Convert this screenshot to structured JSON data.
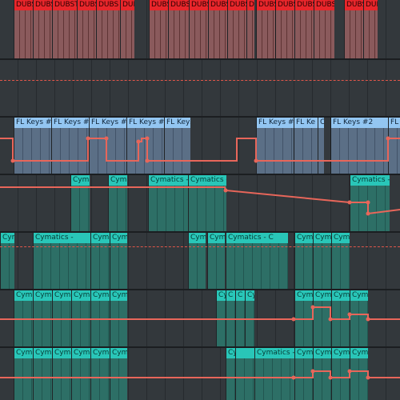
{
  "clips": {
    "dubs": "DUBS",
    "dubs_trunc": "DUBST",
    "fl_keys": "FL Keys #2",
    "fl_keys_trunc": "FL Ke",
    "cymatics_trunc": "Cyma",
    "cymatics_dash": "Cymatics -",
    "cymatics_dash_sp": "Cymatics - ",
    "cymatics_dash2": "Cymatics - C",
    "cymatics_short": "Cymat",
    "cy": "Cy",
    "c": "C",
    "cym": "Cym"
  },
  "colors": {
    "automation": "#e8665a",
    "red_clip": "#e8262b",
    "blue_clip": "#93c6f2",
    "teal_clip": "#29c6b8"
  }
}
